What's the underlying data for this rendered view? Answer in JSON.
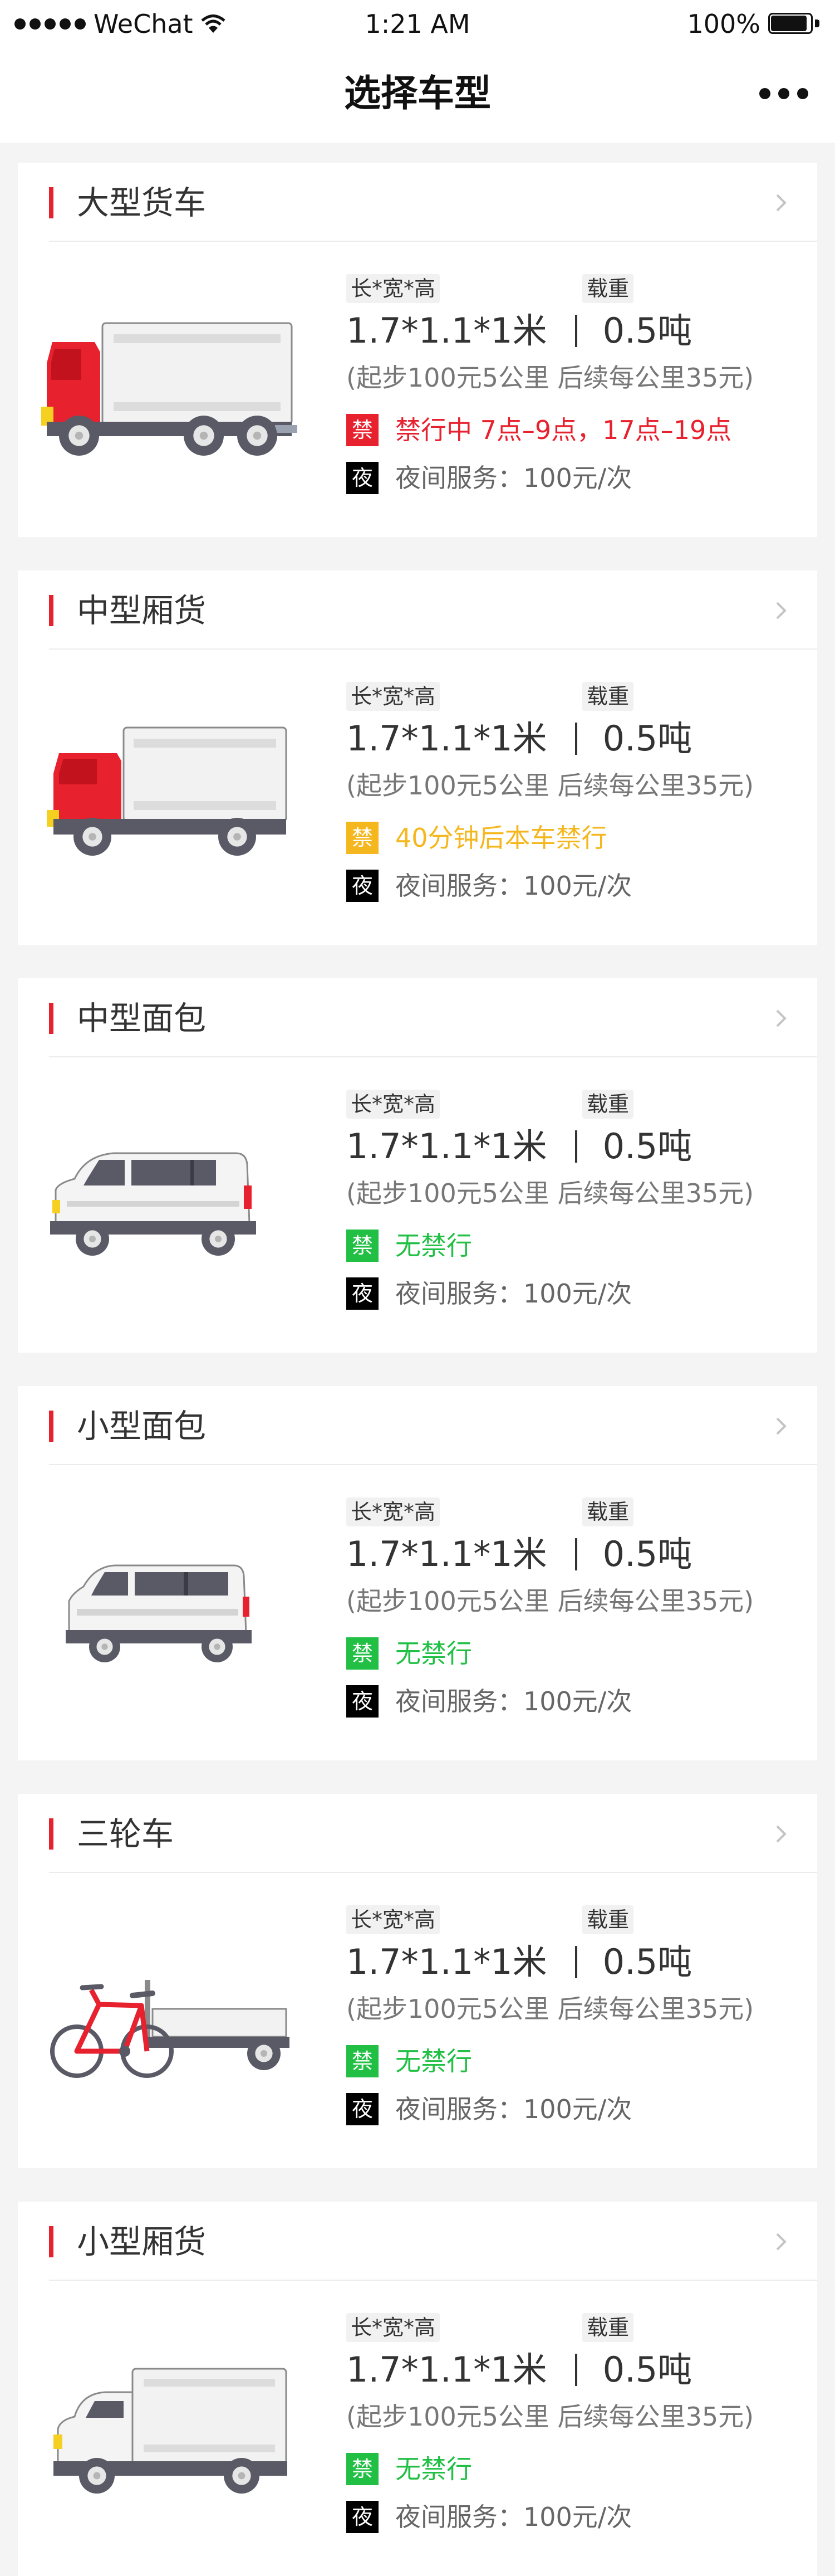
{
  "status_bar": {
    "carrier": "WeChat",
    "time": "1:21 AM",
    "battery": "100%"
  },
  "nav": {
    "title": "选择车型"
  },
  "labels": {
    "dims": "长*宽*高",
    "load": "载重",
    "ban_icon": "禁",
    "night_icon": "夜"
  },
  "colors": {
    "accent": "#e8212f",
    "warning": "#f5b71e",
    "ok": "#21c045",
    "night": "#000000"
  },
  "vehicles": [
    {
      "name": "大型货车",
      "icon": "large-truck-icon",
      "dims": "1.7*1.1*1米",
      "load": "0.5吨",
      "pricing": "(起步100元5公里   后续每公里35元)",
      "ban_text": "禁行中  7点–9点，17点–19点",
      "ban_status": "banned",
      "night_service": "夜间服务：100元/次"
    },
    {
      "name": "中型厢货",
      "icon": "medium-box-truck-icon",
      "dims": "1.7*1.1*1米",
      "load": "0.5吨",
      "pricing": "(起步100元5公里   后续每公里35元)",
      "ban_text": "40分钟后本车禁行",
      "ban_status": "warning",
      "night_service": "夜间服务：100元/次"
    },
    {
      "name": "中型面包",
      "icon": "medium-van-icon",
      "dims": "1.7*1.1*1米",
      "load": "0.5吨",
      "pricing": "(起步100元5公里   后续每公里35元)",
      "ban_text": "无禁行",
      "ban_status": "ok",
      "night_service": "夜间服务：100元/次"
    },
    {
      "name": "小型面包",
      "icon": "small-van-icon",
      "dims": "1.7*1.1*1米",
      "load": "0.5吨",
      "pricing": "(起步100元5公里   后续每公里35元)",
      "ban_text": "无禁行",
      "ban_status": "ok",
      "night_service": "夜间服务：100元/次"
    },
    {
      "name": "三轮车",
      "icon": "tricycle-icon",
      "dims": "1.7*1.1*1米",
      "load": "0.5吨",
      "pricing": "(起步100元5公里   后续每公里35元)",
      "ban_text": "无禁行",
      "ban_status": "ok",
      "night_service": "夜间服务：100元/次"
    },
    {
      "name": "小型厢货",
      "icon": "small-box-truck-icon",
      "dims": "1.7*1.1*1米",
      "load": "0.5吨",
      "pricing": "(起步100元5公里   后续每公里35元)",
      "ban_text": "无禁行",
      "ban_status": "ok",
      "night_service": "夜间服务：100元/次"
    }
  ]
}
